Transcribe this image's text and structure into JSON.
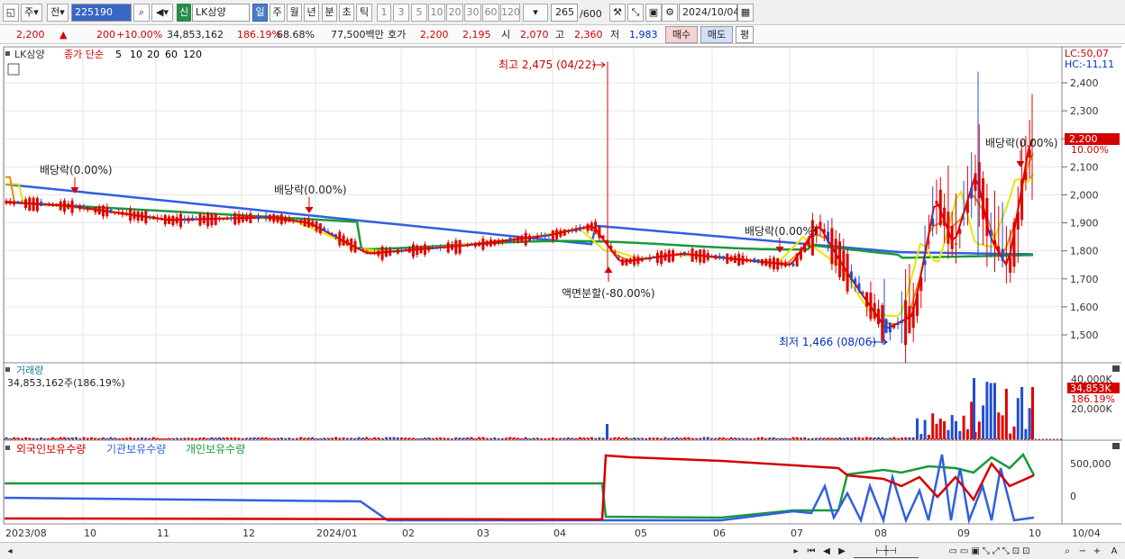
{
  "toolbar": {
    "period_main": "주",
    "mode": "전",
    "code": "225190",
    "stock_badge": "신",
    "stock_name": "LK삼양",
    "periods": [
      "일",
      "주",
      "월",
      "년",
      "분",
      "초",
      "틱"
    ],
    "minutes": [
      "1",
      "3",
      "5",
      "10",
      "20",
      "30",
      "60",
      "120"
    ],
    "count": "265",
    "total": "/600",
    "date": "2024/10/04"
  },
  "quote": {
    "price": "2,200",
    "change": "200",
    "rate": "+10.00%",
    "volume": "34,853,162",
    "vol_ratio": "186.19%",
    "turnover": "68.68%",
    "amount": "77,500백만",
    "hoga_label": "호가",
    "ask": "2,200",
    "bid": "2,195",
    "open_label": "시",
    "open": "2,070",
    "high_label": "고",
    "high": "2,360",
    "low_label": "저",
    "low": "1,983",
    "buy_btn": "매수",
    "sell_btn": "매도",
    "avg_btn": "평"
  },
  "price_panel": {
    "legend_name": "LK삼양",
    "legend_ma_label": "종가 단순",
    "ma_periods": [
      "5",
      "10",
      "20",
      "60",
      "120"
    ],
    "ma_colors": [
      "#e00000",
      "#f08a00",
      "#e6e600",
      "#1a9a3a",
      "#3060e0"
    ],
    "lc": "LC:50,07",
    "hc": "HC:-11,11",
    "y_ticks": [
      "2,400",
      "2,300",
      "2,200",
      "2,100",
      "2,000",
      "1,900",
      "1,800",
      "1,700",
      "1,600",
      "1,500"
    ],
    "price_tag": "2,200",
    "rate_tag": "10.00%",
    "annotations": {
      "high": "최고 2,475 (04/22)",
      "low": "최저 1,466 (08/06)",
      "div1": "배당락(0.00%)",
      "div2": "배당락(0.00%)",
      "div3": "배당락(0.00%)",
      "div4": "배당락(0.00%)",
      "split": "액면분할(-80.00%)"
    }
  },
  "volume_panel": {
    "title": "거래량",
    "value": "34,853,162주(186.19%)",
    "y_ticks": [
      "40,000K",
      "20,000K"
    ],
    "tag": "34,853K",
    "tag2": "186.19%"
  },
  "holding_panel": {
    "legends": [
      {
        "label": "외국인보유수량",
        "color": "#d40000"
      },
      {
        "label": "기관보유수량",
        "color": "#3060e0"
      },
      {
        "label": "개인보유수량",
        "color": "#1a9a3a"
      }
    ],
    "y_ticks": [
      "500,000",
      "0"
    ]
  },
  "x_axis": {
    "labels": [
      "2023/08",
      "10",
      "11",
      "12",
      "2024/01",
      "02",
      "03",
      "04",
      "05",
      "06",
      "07",
      "08",
      "09",
      "10",
      "10/04"
    ]
  }
}
